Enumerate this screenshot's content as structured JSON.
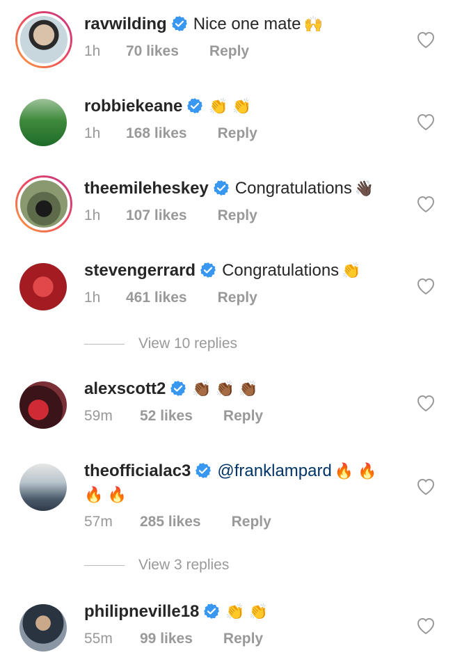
{
  "comments": [
    {
      "username": "ravwilding",
      "text": "Nice one mate",
      "emoji": "🙌",
      "mention": "",
      "time": "1h",
      "likes": "70 likes",
      "reply": "Reply",
      "story_ring": true,
      "avatar_color": "#c8d6dd"
    },
    {
      "username": "robbiekeane",
      "text": "",
      "emoji": "👏 👏",
      "mention": "",
      "time": "1h",
      "likes": "168 likes",
      "reply": "Reply",
      "story_ring": false,
      "avatar_color": "#4f8a4c"
    },
    {
      "username": "theemileheskey",
      "text": "Congratulations",
      "emoji": "👋🏿",
      "mention": "",
      "time": "1h",
      "likes": "107 likes",
      "reply": "Reply",
      "story_ring": true,
      "avatar_color": "#4b5a3f"
    },
    {
      "username": "stevengerrard",
      "text": "Congratulations",
      "emoji": "👏",
      "mention": "",
      "time": "1h",
      "likes": "461 likes",
      "reply": "Reply",
      "story_ring": false,
      "avatar_color": "#b3262a"
    },
    {
      "username": "alexscott2",
      "text": "",
      "emoji": "👏🏾 👏🏾 👏🏾",
      "mention": "",
      "time": "59m",
      "likes": "52 likes",
      "reply": "Reply",
      "story_ring": false,
      "avatar_color": "#5a1c22"
    },
    {
      "username": "theofficialac3",
      "text": "",
      "emoji": "🔥 🔥",
      "emoji2": "🔥 🔥",
      "mention": "@franklampard",
      "time": "57m",
      "likes": "285 likes",
      "reply": "Reply",
      "story_ring": false,
      "avatar_color": "#6f8aa0"
    },
    {
      "username": "philipneville18",
      "text": "",
      "emoji": "👏 👏",
      "mention": "",
      "time": "55m",
      "likes": "99 likes",
      "reply": "Reply",
      "story_ring": false,
      "avatar_color": "#3b4350"
    }
  ],
  "view_replies": [
    {
      "label": "View 10 replies"
    },
    {
      "label": "View 3 replies"
    }
  ],
  "colors": {
    "verified": "#3897f0",
    "meta_text": "#999999",
    "mention": "#003569"
  },
  "icons": {
    "verified": "verified-badge-icon",
    "heart": "heart-outline-icon"
  }
}
